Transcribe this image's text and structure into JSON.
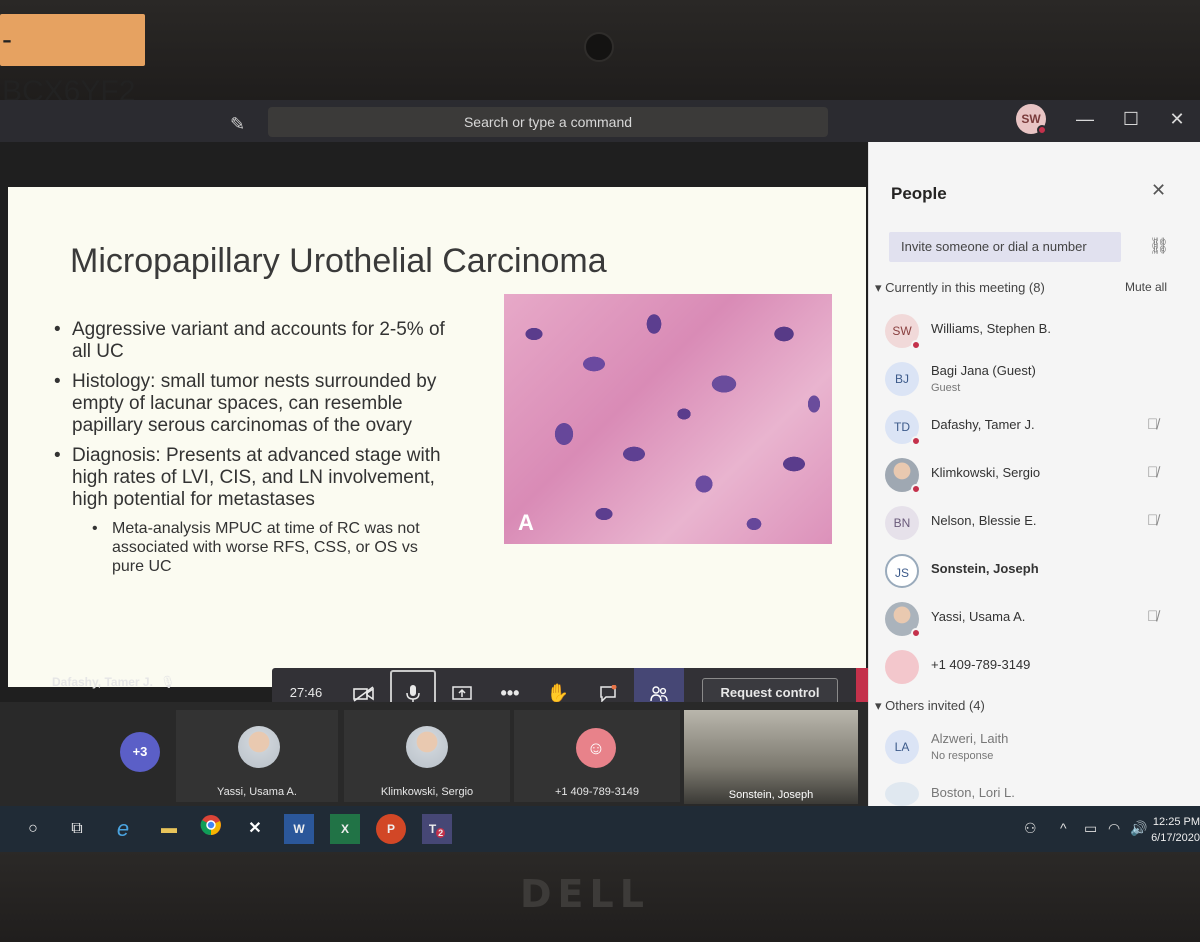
{
  "sticker": {
    "text": "-BCX6YF2"
  },
  "titlebar": {
    "search_placeholder": "Search or type a command",
    "user_initials": "SW",
    "minimize": "—",
    "maximize": "☐",
    "close": "✕"
  },
  "slide": {
    "title": "Micropapillary Urothelial Carcinoma",
    "bullets": [
      "Aggressive variant and accounts for 2-5% of all UC",
      "Histology: small tumor nests surrounded by empty of lacunar spaces, can resemble papillary serous carcinomas of the ovary",
      "Diagnosis: Presents at advanced stage with high rates of LVI, CIS, and LN involvement, high potential for metastases"
    ],
    "sub_bullet": "Meta-analysis MPUC at time of RC was not associated with worse RFS, CSS, or OS vs pure UC",
    "image_label": "A"
  },
  "presenter": {
    "name": "Dafashy, Tamer J.",
    "mic_icon": "🎙̸"
  },
  "controls": {
    "timer": "27:46",
    "request_control": "Request control",
    "icons": [
      "camera-off-icon",
      "microphone-icon",
      "share-icon",
      "more-icon",
      "raise-hand-icon",
      "chat-icon",
      "people-icon",
      "hang-up-icon"
    ]
  },
  "gallery": {
    "overflow_count": "+3",
    "tiles": [
      {
        "name": "Yassi, Usama A."
      },
      {
        "name": "Klimkowski, Sergio"
      },
      {
        "name": "+1 409-789-3149"
      },
      {
        "name": "Sonstein, Joseph"
      }
    ]
  },
  "people_panel": {
    "title": "People",
    "invite_placeholder": "Invite someone or dial a number",
    "current_section": "Currently in this meeting (8)",
    "mute_all": "Mute all",
    "others_section": "Others invited (4)",
    "participants": [
      {
        "initials": "SW",
        "name": "Williams, Stephen B.",
        "sub": "",
        "muted": false
      },
      {
        "initials": "BJ",
        "name": "Bagi Jana (Guest)",
        "sub": "Guest",
        "muted": false
      },
      {
        "initials": "TD",
        "name": "Dafashy, Tamer J.",
        "sub": "",
        "muted": true
      },
      {
        "initials": "",
        "name": "Klimkowski, Sergio",
        "sub": "",
        "muted": true
      },
      {
        "initials": "BN",
        "name": "Nelson, Blessie E.",
        "sub": "",
        "muted": true
      },
      {
        "initials": "JS",
        "name": "Sonstein, Joseph",
        "sub": "",
        "muted": false
      },
      {
        "initials": "",
        "name": "Yassi, Usama A.",
        "sub": "",
        "muted": true
      },
      {
        "initials": "",
        "name": "+1 409-789-3149",
        "sub": "",
        "muted": false
      }
    ],
    "invited": [
      {
        "initials": "LA",
        "name": "Alzweri, Laith",
        "sub": "No response"
      },
      {
        "initials": "",
        "name": "Boston, Lori L.",
        "sub": ""
      }
    ]
  },
  "taskbar": {
    "time": "12:25 PM",
    "date": "6/17/2020",
    "teams_badge": "2"
  },
  "brand": "DELL",
  "colors": {
    "accent": "#5b5fc7",
    "hangup": "#c4314b",
    "slide_bg": "#fbfbf1"
  }
}
